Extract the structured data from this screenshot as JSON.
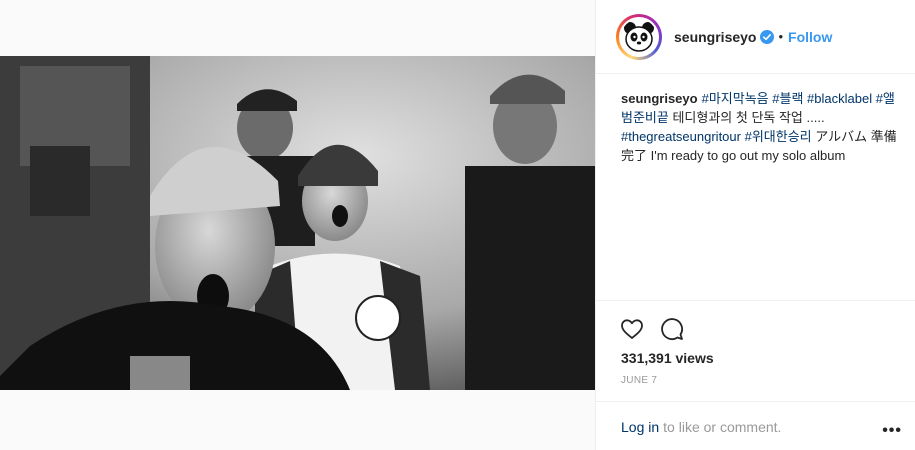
{
  "header": {
    "username": "seungriseyo",
    "separator": "•",
    "follow_label": "Follow"
  },
  "caption": {
    "username": "seungriseyo",
    "parts": [
      {
        "text": "#마지막녹음",
        "tag": true
      },
      {
        "text": " ",
        "tag": false
      },
      {
        "text": "#블랙",
        "tag": true
      },
      {
        "text": " ",
        "tag": false
      },
      {
        "text": "#blacklabel",
        "tag": true
      },
      {
        "text": " ",
        "tag": false
      },
      {
        "text": "#앨범준비끝",
        "tag": true
      },
      {
        "text": " 테디형과의 첫 단독 작업 ..... ",
        "tag": false
      },
      {
        "text": "#thegreatseungritour",
        "tag": true
      },
      {
        "text": " ",
        "tag": false
      },
      {
        "text": "#위대한승리",
        "tag": true
      },
      {
        "text": " アルバム 準備完了 I'm ready to go out my solo album",
        "tag": false
      }
    ]
  },
  "stats": {
    "views": "331,391 views",
    "date": "JUNE 7"
  },
  "footer": {
    "login_label": "Log in",
    "rest": "to like or comment.",
    "more": "•••"
  },
  "icons": {
    "verified": "verified-badge-icon",
    "like": "heart-icon",
    "comment": "comment-icon",
    "more": "more-options-icon"
  },
  "colors": {
    "accent": "#3897f0",
    "hashtag": "#003569",
    "muted": "#999999",
    "text": "#262626"
  }
}
